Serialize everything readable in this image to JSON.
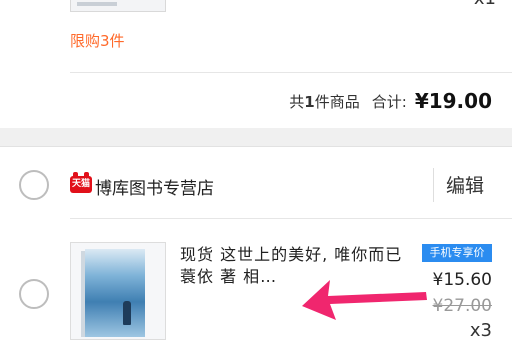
{
  "previous_item": {
    "quantity": "x1",
    "limit_text": "限购3件"
  },
  "summary": {
    "count_prefix": "共",
    "count_number": "1",
    "count_suffix": "件商品",
    "total_label": "合计:",
    "total_price": "¥19.00"
  },
  "shop": {
    "badge_text": "天猫",
    "name": "博库图书专营店",
    "edit_label": "编辑"
  },
  "product": {
    "title": "现货 这世上的美好, 唯你而已 蓑依 著 相…",
    "badge": "手机专享价",
    "price": "¥15.60",
    "original_price": "¥27.00",
    "quantity": "x3"
  },
  "colors": {
    "limit": "#ff6a2b",
    "badge_bg": "#2b8cf0",
    "tmall_red": "#e1101a",
    "arrow": "#f0266e"
  }
}
